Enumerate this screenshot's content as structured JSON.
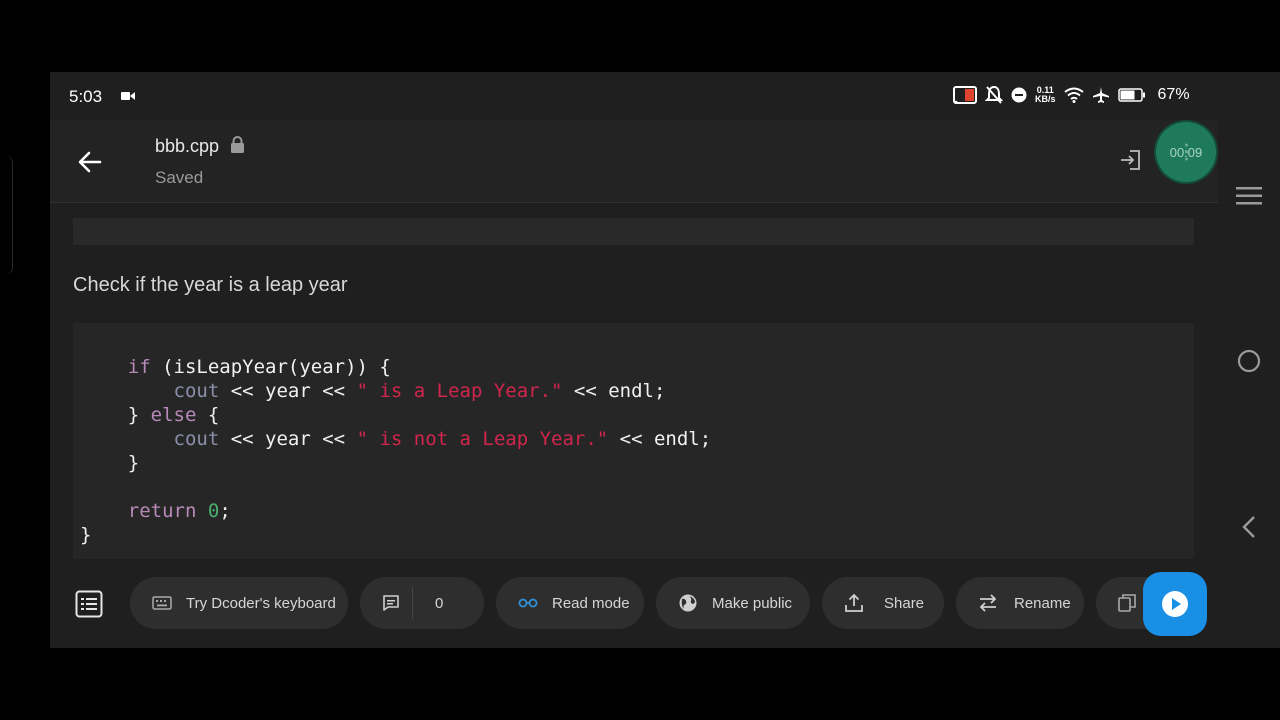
{
  "status_bar": {
    "time": "5:03",
    "net_speed_value": "0.11",
    "net_speed_unit": "KB/s",
    "battery": "67%"
  },
  "header": {
    "file_name": "bbb.cpp",
    "save_status": "Saved",
    "timer": "00:09"
  },
  "content": {
    "heading": "Check if the year is a leap year"
  },
  "toolbar": {
    "keyboard_label": "Try Dcoder's keyboard",
    "comments_count": "0",
    "read_mode_label": "Read mode",
    "make_public_label": "Make public",
    "share_label": "Share",
    "rename_label": "Rename"
  },
  "colors": {
    "background": "#1f1f1f",
    "code_background": "#262626",
    "keyword": "#b88ab8",
    "string": "#d0254c",
    "number": "#4cae6e",
    "accent_blue": "#1a8fe6",
    "timer_green": "#1e7a5b"
  }
}
